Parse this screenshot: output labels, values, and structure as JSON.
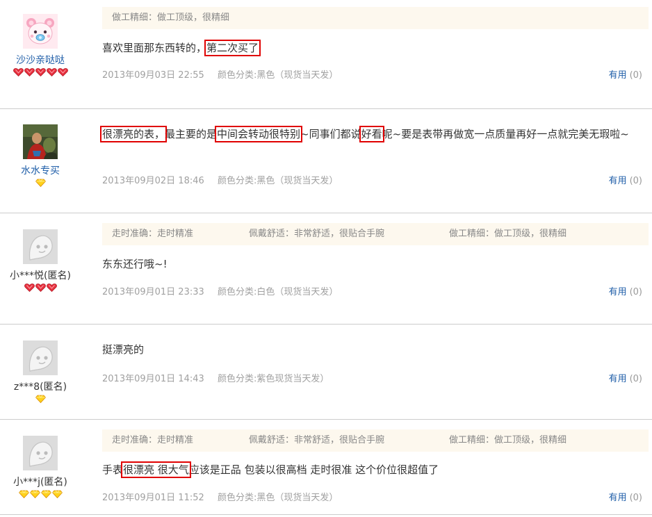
{
  "colors": {
    "link": "#1f5ea8",
    "highlight_border": "#e00000",
    "tag_bg": "#fdf8ee",
    "divider": "#cccccc"
  },
  "reviews": [
    {
      "user": {
        "name": "沙沙亲哒哒",
        "avatar": "pink-bear-avatar",
        "badge_icon": "heart-badge-icon",
        "badge_count": 5
      },
      "tags": [
        {
          "label": "做工精细：做工顶级，很精细"
        }
      ],
      "content_parts": [
        "喜欢里面那东西转的，",
        "第二次买了"
      ],
      "date": "2013年09月03日 22:55",
      "variant": "颜色分类:黑色（现货当天发）",
      "useful_label": "有用",
      "useful_count": "(0)"
    },
    {
      "user": {
        "name": "水水专买",
        "avatar": "photo-avatar",
        "badge_icon": "diamond-badge-icon",
        "badge_count": 1
      },
      "tags": [],
      "content_parts": [
        "很漂亮的表，",
        "最主要的是",
        "中间会转动很特别",
        "~同事们都说",
        "好看",
        "呢~要是表带再做宽一点质量再好一点就完美无瑕啦~"
      ],
      "date": "2013年09月02日 18:46",
      "variant": "颜色分类:黑色（现货当天发）",
      "useful_label": "有用",
      "useful_count": "(0)"
    },
    {
      "user": {
        "name": "小***悦(匿名)",
        "avatar": "default-face-avatar",
        "badge_icon": "heart-badge-icon",
        "badge_count": 3
      },
      "tags": [
        {
          "label": "走时准确：走时精准"
        },
        {
          "label": "佩戴舒适：非常舒适，很贴合手腕"
        },
        {
          "label": "做工精细：做工顶级，很精细"
        }
      ],
      "content_parts": [
        "东东还行哦~!"
      ],
      "date": "2013年09月01日 23:33",
      "variant": "颜色分类:白色（现货当天发）",
      "useful_label": "有用",
      "useful_count": "(0)"
    },
    {
      "user": {
        "name": "z***8(匿名)",
        "avatar": "default-face-avatar",
        "badge_icon": "diamond-badge-icon",
        "badge_count": 1
      },
      "tags": [],
      "content_parts": [
        "挺漂亮的"
      ],
      "date": "2013年09月01日 14:43",
      "variant": "颜色分类:紫色现货当天发）",
      "useful_label": "有用",
      "useful_count": "(0)"
    },
    {
      "user": {
        "name": "小***j(匿名)",
        "avatar": "default-face-avatar",
        "badge_icon": "diamond-badge-icon",
        "badge_count": 4
      },
      "tags": [
        {
          "label": "走时准确：走时精准"
        },
        {
          "label": "佩戴舒适：非常舒适，很贴合手腕"
        },
        {
          "label": "做工精细：做工顶级，很精细"
        }
      ],
      "content_parts": [
        "手表",
        "很漂亮 很大气",
        "应该是正品 包装以很高档 走时很准 这个价位很超值了"
      ],
      "date": "2013年09月01日 11:52",
      "variant": "颜色分类:黑色（现货当天发）",
      "useful_label": "有用",
      "useful_count": "(0)"
    }
  ]
}
